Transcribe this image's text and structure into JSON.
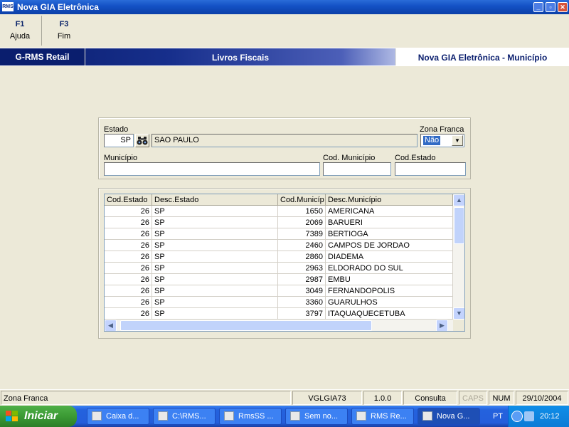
{
  "window": {
    "icon_text": "RMS",
    "title": "Nova GIA Eletrônica",
    "minimize_glyph": "_",
    "maximize_glyph": "▫",
    "close_glyph": "✕"
  },
  "function_keys": [
    {
      "key": "F1",
      "label": "Ajuda"
    },
    {
      "key": "F3",
      "label": "Fim"
    }
  ],
  "header": {
    "brand": "G-RMS Retail",
    "module": "Livros Fiscais",
    "screen": "Nova GIA Eletrônica - Município"
  },
  "form": {
    "estado_label": "Estado",
    "estado_value": "SP",
    "estado_desc": "SAO PAULO",
    "zona_franca_label": "Zona Franca",
    "zona_franca_value": "Não",
    "municipio_label": "Município",
    "municipio_value": "",
    "cod_municipio_label": "Cod. Município",
    "cod_municipio_value": "",
    "cod_estado_label": "Cod.Estado",
    "cod_estado_value": ""
  },
  "grid": {
    "columns": [
      "Cod.Estado",
      "Desc.Estado",
      "Cod.Municíp",
      "Desc.Município"
    ],
    "rows": [
      [
        "26",
        "SP",
        "1650",
        "AMERICANA"
      ],
      [
        "26",
        "SP",
        "2069",
        "BARUERI"
      ],
      [
        "26",
        "SP",
        "7389",
        "BERTIOGA"
      ],
      [
        "26",
        "SP",
        "2460",
        "CAMPOS DE JORDAO"
      ],
      [
        "26",
        "SP",
        "2860",
        "DIADEMA"
      ],
      [
        "26",
        "SP",
        "2963",
        "ELDORADO DO SUL"
      ],
      [
        "26",
        "SP",
        "2987",
        "EMBU"
      ],
      [
        "26",
        "SP",
        "3049",
        "FERNANDOPOLIS"
      ],
      [
        "26",
        "SP",
        "3360",
        "GUARULHOS"
      ],
      [
        "26",
        "SP",
        "3797",
        "ITAQUAQUECETUBA"
      ]
    ]
  },
  "status_bar": {
    "message": "Zona Franca",
    "program": "VGLGIA73",
    "version": "1.0.0",
    "mode": "Consulta",
    "caps": "CAPS",
    "num": "NUM",
    "date": "29/10/2004"
  },
  "taskbar": {
    "start_label": "Iniciar",
    "tasks": [
      "Caixa d...",
      "C:\\RMS...",
      "RmsSS ...",
      "Sem no...",
      "RMS Re...",
      "Nova G..."
    ],
    "language": "PT",
    "clock": "20:12"
  },
  "colors": {
    "title_bar": "#0b3fa8",
    "header_band": "#0a1e6e",
    "selection": "#316ac5",
    "window_bg": "#ece9d8",
    "start_button": "#3b9a34"
  }
}
